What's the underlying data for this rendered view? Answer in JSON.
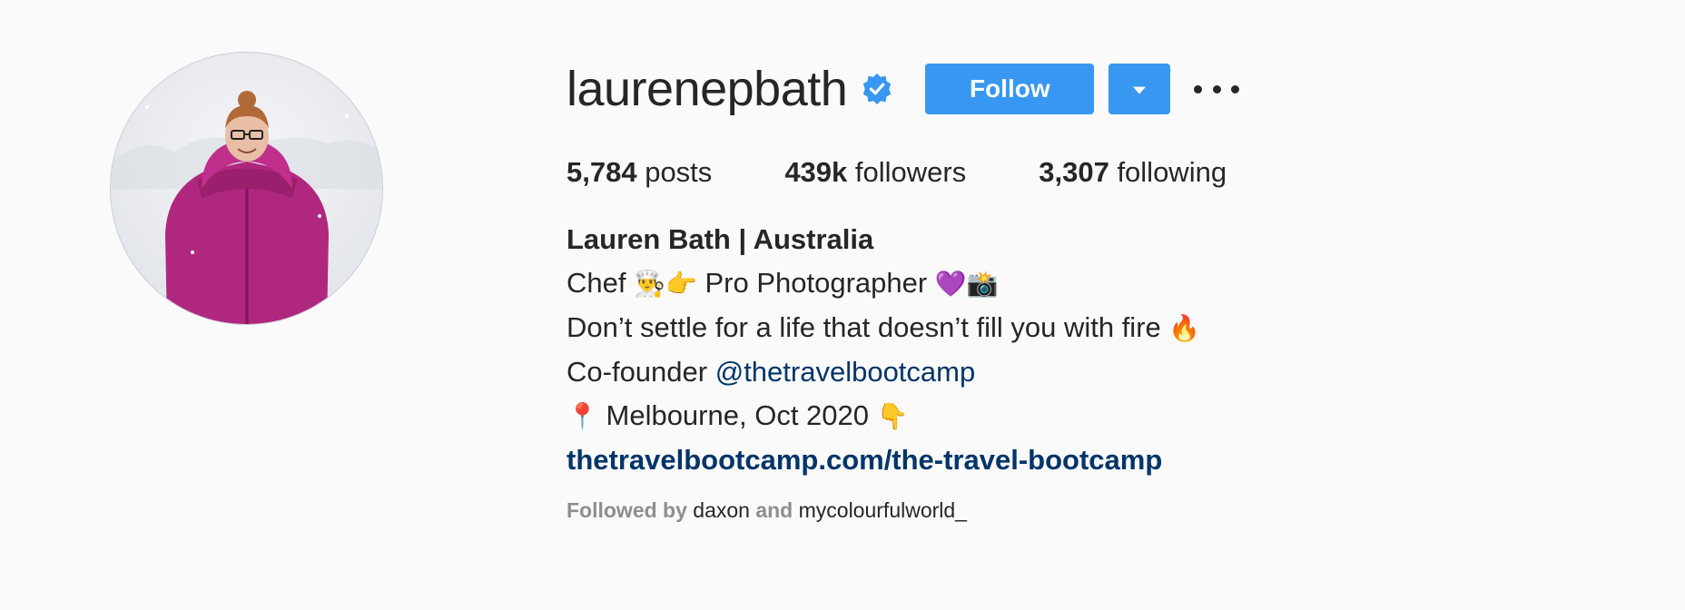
{
  "profile": {
    "username": "laurenepbath",
    "follow_label": "Follow",
    "stats": {
      "posts_count": "5,784",
      "posts_label": "posts",
      "followers_count": "439k",
      "followers_label": "followers",
      "following_count": "3,307",
      "following_label": "following"
    },
    "full_name": "Lauren Bath | Australia",
    "bio": {
      "line1_a": "Chef",
      "line1_b": "Pro Photographer",
      "line2": "Don’t settle for a life that doesn’t fill you with fire",
      "line3_prefix": "Co-founder ",
      "line3_mention": "@thetravelbootcamp",
      "line4": "Melbourne, Oct 2020"
    },
    "website": "thetravelbootcamp.com/the-travel-bootcamp",
    "followed_by": {
      "prefix": "Followed by",
      "account1": "daxon",
      "conjunction": "and",
      "account2": "mycolourfulworld_"
    },
    "emoji": {
      "chef": "👨‍🍳",
      "point_left": "👉",
      "purple_heart": "💜",
      "camera_flash": "📸",
      "fire": "🔥",
      "pin": "📍",
      "point_down": "👇"
    }
  },
  "colors": {
    "accent": "#3897f0",
    "link": "#003569",
    "muted": "#8e8e8e",
    "text": "#262626",
    "verified": "#3897f0",
    "jacket": "#b0277f"
  }
}
